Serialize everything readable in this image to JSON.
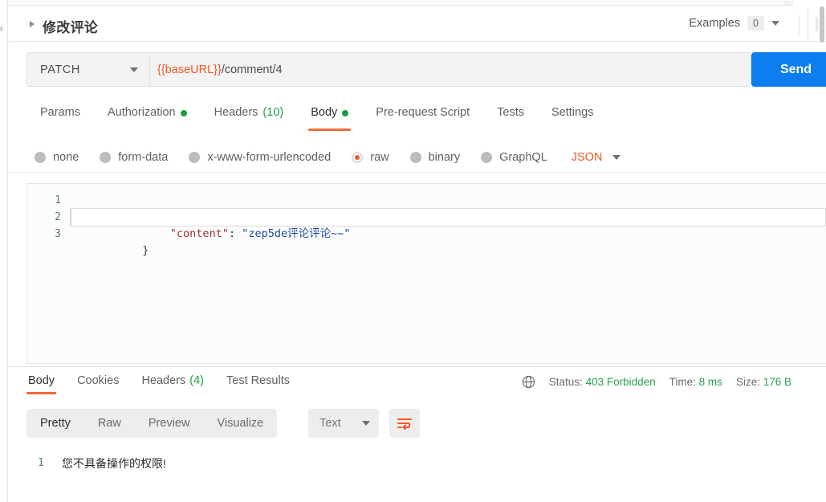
{
  "request": {
    "title": "修改评论",
    "collapse_icon": "triangle-right-icon",
    "examples_label": "Examples",
    "examples_count": "0",
    "method": "PATCH",
    "url_variable": "{{baseURL}}",
    "url_path": "/comment/4",
    "send_label": "Send",
    "tabs": [
      {
        "label": "Params",
        "active": false,
        "indicator": "",
        "count": ""
      },
      {
        "label": "Authorization",
        "active": false,
        "indicator": "dot",
        "count": ""
      },
      {
        "label": "Headers",
        "active": false,
        "indicator": "",
        "count": "(10)"
      },
      {
        "label": "Body",
        "active": true,
        "indicator": "dot",
        "count": ""
      },
      {
        "label": "Pre-request Script",
        "active": false,
        "indicator": "",
        "count": ""
      },
      {
        "label": "Tests",
        "active": false,
        "indicator": "",
        "count": ""
      },
      {
        "label": "Settings",
        "active": false,
        "indicator": "",
        "count": ""
      }
    ],
    "body_types": [
      {
        "label": "none",
        "selected": false
      },
      {
        "label": "form-data",
        "selected": false
      },
      {
        "label": "x-www-form-urlencoded",
        "selected": false
      },
      {
        "label": "raw",
        "selected": true
      },
      {
        "label": "binary",
        "selected": false
      },
      {
        "label": "GraphQL",
        "selected": false
      }
    ],
    "raw_format": "JSON",
    "editor": {
      "lines": [
        {
          "num": "1",
          "active": false,
          "brace": "{",
          "key": "",
          "colon": "",
          "value": ""
        },
        {
          "num": "2",
          "active": true,
          "brace": "",
          "key": "\"content\"",
          "colon": ":",
          "value": "\"zep5de评论评论~~\""
        },
        {
          "num": "3",
          "active": false,
          "brace": "}",
          "key": "",
          "colon": "",
          "value": ""
        }
      ]
    }
  },
  "response": {
    "tabs": [
      {
        "label": "Body",
        "active": true,
        "count": ""
      },
      {
        "label": "Cookies",
        "active": false,
        "count": ""
      },
      {
        "label": "Headers",
        "active": false,
        "count": "(4)"
      },
      {
        "label": "Test Results",
        "active": false,
        "count": ""
      }
    ],
    "globe_icon": "globe-icon",
    "status_label": "Status:",
    "status_value": "403 Forbidden",
    "time_label": "Time:",
    "time_value": "8 ms",
    "size_label": "Size:",
    "size_value": "176 B",
    "view_modes": [
      {
        "label": "Pretty",
        "active": true
      },
      {
        "label": "Raw",
        "active": false
      },
      {
        "label": "Preview",
        "active": false
      },
      {
        "label": "Visualize",
        "active": false
      }
    ],
    "format": "Text",
    "wrap_icon": "word-wrap-icon",
    "body_line_number": "1",
    "body_text": "您不具备操作的权限!"
  },
  "colors": {
    "accent_orange": "#f05a28",
    "send_blue": "#0d7ef0",
    "status_green": "#2aa14f",
    "indicator_green": "#1a9c45"
  }
}
